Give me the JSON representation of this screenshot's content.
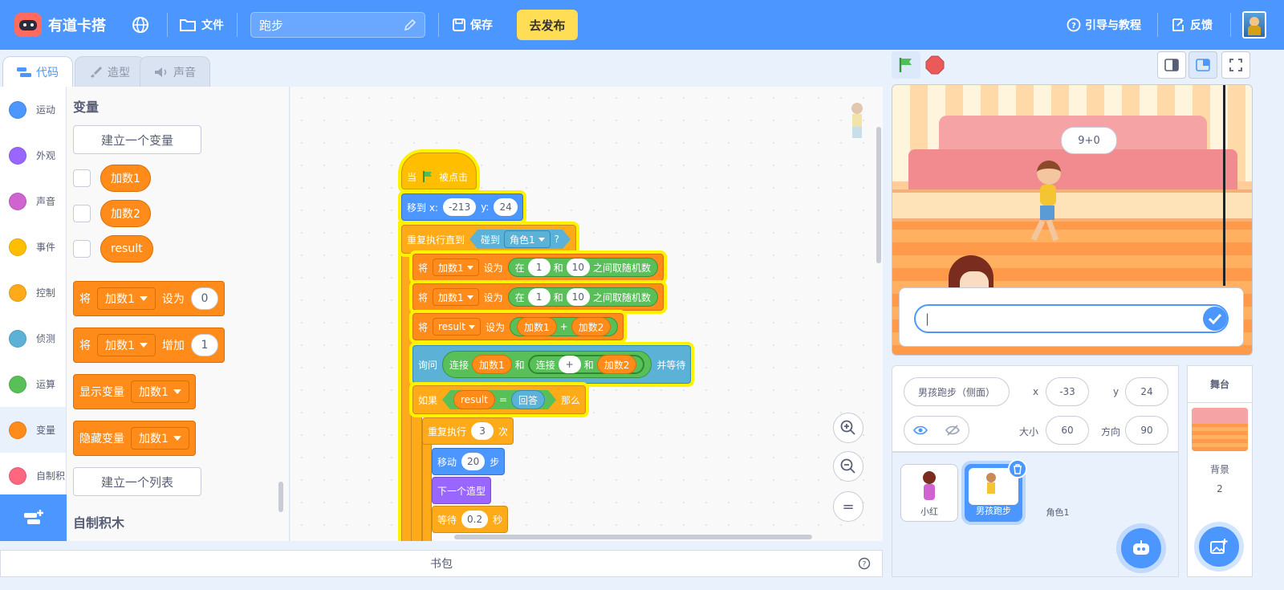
{
  "topbar": {
    "brand": "有道卡搭",
    "file_menu": "文件",
    "project_title": "跑步",
    "save": "保存",
    "publish": "去发布",
    "tutorial": "引导与教程",
    "feedback": "反馈"
  },
  "tabs": [
    "代码",
    "造型",
    "声音"
  ],
  "categories": [
    {
      "label": "运动",
      "color": "#4c97ff"
    },
    {
      "label": "外观",
      "color": "#9966ff"
    },
    {
      "label": "声音",
      "color": "#cf63cf"
    },
    {
      "label": "事件",
      "color": "#ffbf00"
    },
    {
      "label": "控制",
      "color": "#ffab19"
    },
    {
      "label": "侦测",
      "color": "#5cb1d6"
    },
    {
      "label": "运算",
      "color": "#59c059"
    },
    {
      "label": "变量",
      "color": "#ff8c1a"
    },
    {
      "label": "自制积",
      "color": "#ff6680"
    }
  ],
  "palette": {
    "heading": "变量",
    "make_variable": "建立一个变量",
    "variables": [
      "加数1",
      "加数2",
      "result"
    ],
    "set_block": {
      "verb": "将",
      "var": "加数1",
      "op": "设为",
      "value": "0"
    },
    "change_block": {
      "verb": "将",
      "var": "加数1",
      "op": "增加",
      "value": "1"
    },
    "show_block": {
      "text": "显示变量",
      "var": "加数1"
    },
    "hide_block": {
      "text": "隐藏变量",
      "var": "加数1"
    },
    "make_list": "建立一个列表",
    "my_blocks_heading": "自制积木"
  },
  "script": {
    "hat": {
      "pre": "当",
      "post": "被点击"
    },
    "goto": {
      "label": "移到 x:",
      "x": "-213",
      "ylabel": "y:",
      "y": "24"
    },
    "repeat_until": {
      "label": "重复执行直到",
      "touch": "碰到",
      "target": "角色1",
      "q": "?"
    },
    "set1": {
      "verb": "将",
      "var": "加数1",
      "op": "设为",
      "in": "在",
      "a": "1",
      "and": "和",
      "b": "10",
      "rnd": "之间取随机数"
    },
    "set2": {
      "verb": "将",
      "var": "加数1",
      "op": "设为",
      "in": "在",
      "a": "1",
      "and": "和",
      "b": "10",
      "rnd": "之间取随机数"
    },
    "set3": {
      "verb": "将",
      "var": "result",
      "op": "设为",
      "a": "加数1",
      "plus": "+",
      "b": "加数2"
    },
    "ask": {
      "label": "询问",
      "join": "连接",
      "a": "加数1",
      "and": "和",
      "join2": "连接",
      "plus": "+",
      "and2": "和",
      "b": "加数2",
      "wait": "并等待"
    },
    "if": {
      "label": "如果",
      "a": "result",
      "eq": "=",
      "b": "回答",
      "then": "那么"
    },
    "repeat": {
      "label": "重复执行",
      "n": "3",
      "times": "次"
    },
    "move": {
      "label": "移动",
      "n": "20",
      "steps": "步"
    },
    "next_costume": "下一个造型",
    "wait": {
      "label": "等待",
      "n": "0.2",
      "sec": "秒"
    }
  },
  "zoom": {
    "in": "+",
    "out": "−",
    "reset": "="
  },
  "backpack": "书包",
  "stage": {
    "bubble": "9+0",
    "answer_value": "|"
  },
  "sprite_info": {
    "name": "男孩跑步（侧面）",
    "x_label": "x",
    "x": "-33",
    "y_label": "y",
    "y": "24",
    "size_label": "大小",
    "size": "60",
    "dir_label": "方向",
    "dir": "90"
  },
  "sprites": [
    "小红",
    "男孩跑步",
    "角色1"
  ],
  "stage_pane": {
    "title": "舞台",
    "backdrop_label": "背景",
    "backdrop_count": "2"
  },
  "colors": {
    "accent": "#4c97ff",
    "publish": "#ffdd55",
    "run_flag": "#4cbf56",
    "stop": "#ec5959"
  }
}
